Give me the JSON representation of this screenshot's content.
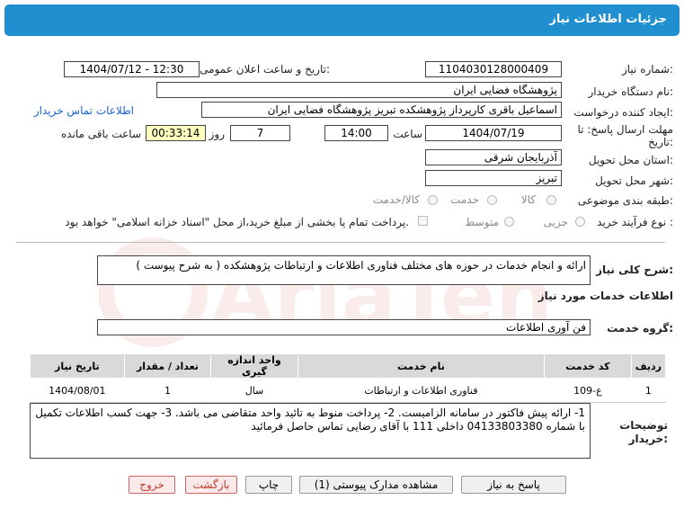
{
  "header": {
    "title": "جزئیات اطلاعات نیاز"
  },
  "form": {
    "need_number_label": "شماره نیاز:",
    "need_number": "1104030128000409",
    "announce_label": "تاریخ و ساعت اعلان عمومی:",
    "announce_value": "1404/07/12 - 12:30",
    "buyer_org_label": "نام دستگاه خریدار:",
    "buyer_org": "پژوهشگاه فضایی ایران",
    "creator_label": "ایجاد کننده درخواست:",
    "creator": "اسماعیل باقری کارپرداز پژوهشکده تبریز پژوهشگاه فضایی ایران",
    "contact_link": "اطلاعات تماس خریدار",
    "deadline_label_1": "مهلت ارسال پاسخ: تا",
    "deadline_label_2": "تاریخ:",
    "deadline_date": "1404/07/19",
    "time_label": "ساعت",
    "deadline_time": "14:00",
    "days_value": "7",
    "days_label": "روز و",
    "remaining_value": "00:33:14",
    "remaining_label": "ساعت باقی مانده",
    "province_label": "استان محل تحویل:",
    "province": "آذربایجان شرقی",
    "city_label": "شهر محل تحویل:",
    "city": "تبریز",
    "category_label": "طبقه بندی موضوعی:",
    "category_options": [
      "کالا",
      "خدمت",
      "کالا/خدمت"
    ],
    "process_label": "نوع فرآیند خرید :",
    "process_options": [
      "جزیی",
      "متوسط"
    ],
    "payment_note": "پرداخت تمام یا بخشی از مبلغ خرید،از محل \"اسناد خزانه اسلامی\" خواهد بود."
  },
  "description": {
    "label": "شرح کلی نیاز:",
    "value": "ارائه و انجام خدمات در حوزه های مختلف فناوری اطلاعات و ارتباطات پژوهشکده ( به شرح پیوست )"
  },
  "services": {
    "section_title": "اطلاعات خدمات مورد نیاز",
    "group_label": "گروه خدمت:",
    "group_value": "فن آوری اطلاعات",
    "columns": [
      "ردیف",
      "کد خدمت",
      "نام خدمت",
      "واحد اندازه گیری",
      "تعداد / مقدار",
      "تاریخ نیاز"
    ],
    "rows": [
      {
        "row": "1",
        "code": "ع-109",
        "name": "فناوری اطلاعات و ارتباطات",
        "unit": "سال",
        "qty": "1",
        "date": "1404/08/01"
      }
    ]
  },
  "notes": {
    "label_1": "توضیحات",
    "label_2": "خریدار:",
    "text": "1- ارائه پیش فاکتور در سامانه الزامیست. 2- پرداخت منوط به تائید واحد متقاضی می باشد. 3- جهت کسب اطلاعات تکمیل با شماره 04133803380 داخلی 111  با آقای رضایی تماس حاصل فرمائید"
  },
  "buttons": {
    "reply": "پاسخ به نیاز",
    "docs": "مشاهده مدارک پیوستی (1)",
    "print": "چاپ",
    "back": "بازگشت",
    "exit": "خروج"
  },
  "watermark": {
    "text": "AriaTender.net"
  },
  "colors": {
    "header_bg": "#1f8fcf",
    "highlight": "#ffffc0",
    "link": "#1a5fd0"
  }
}
